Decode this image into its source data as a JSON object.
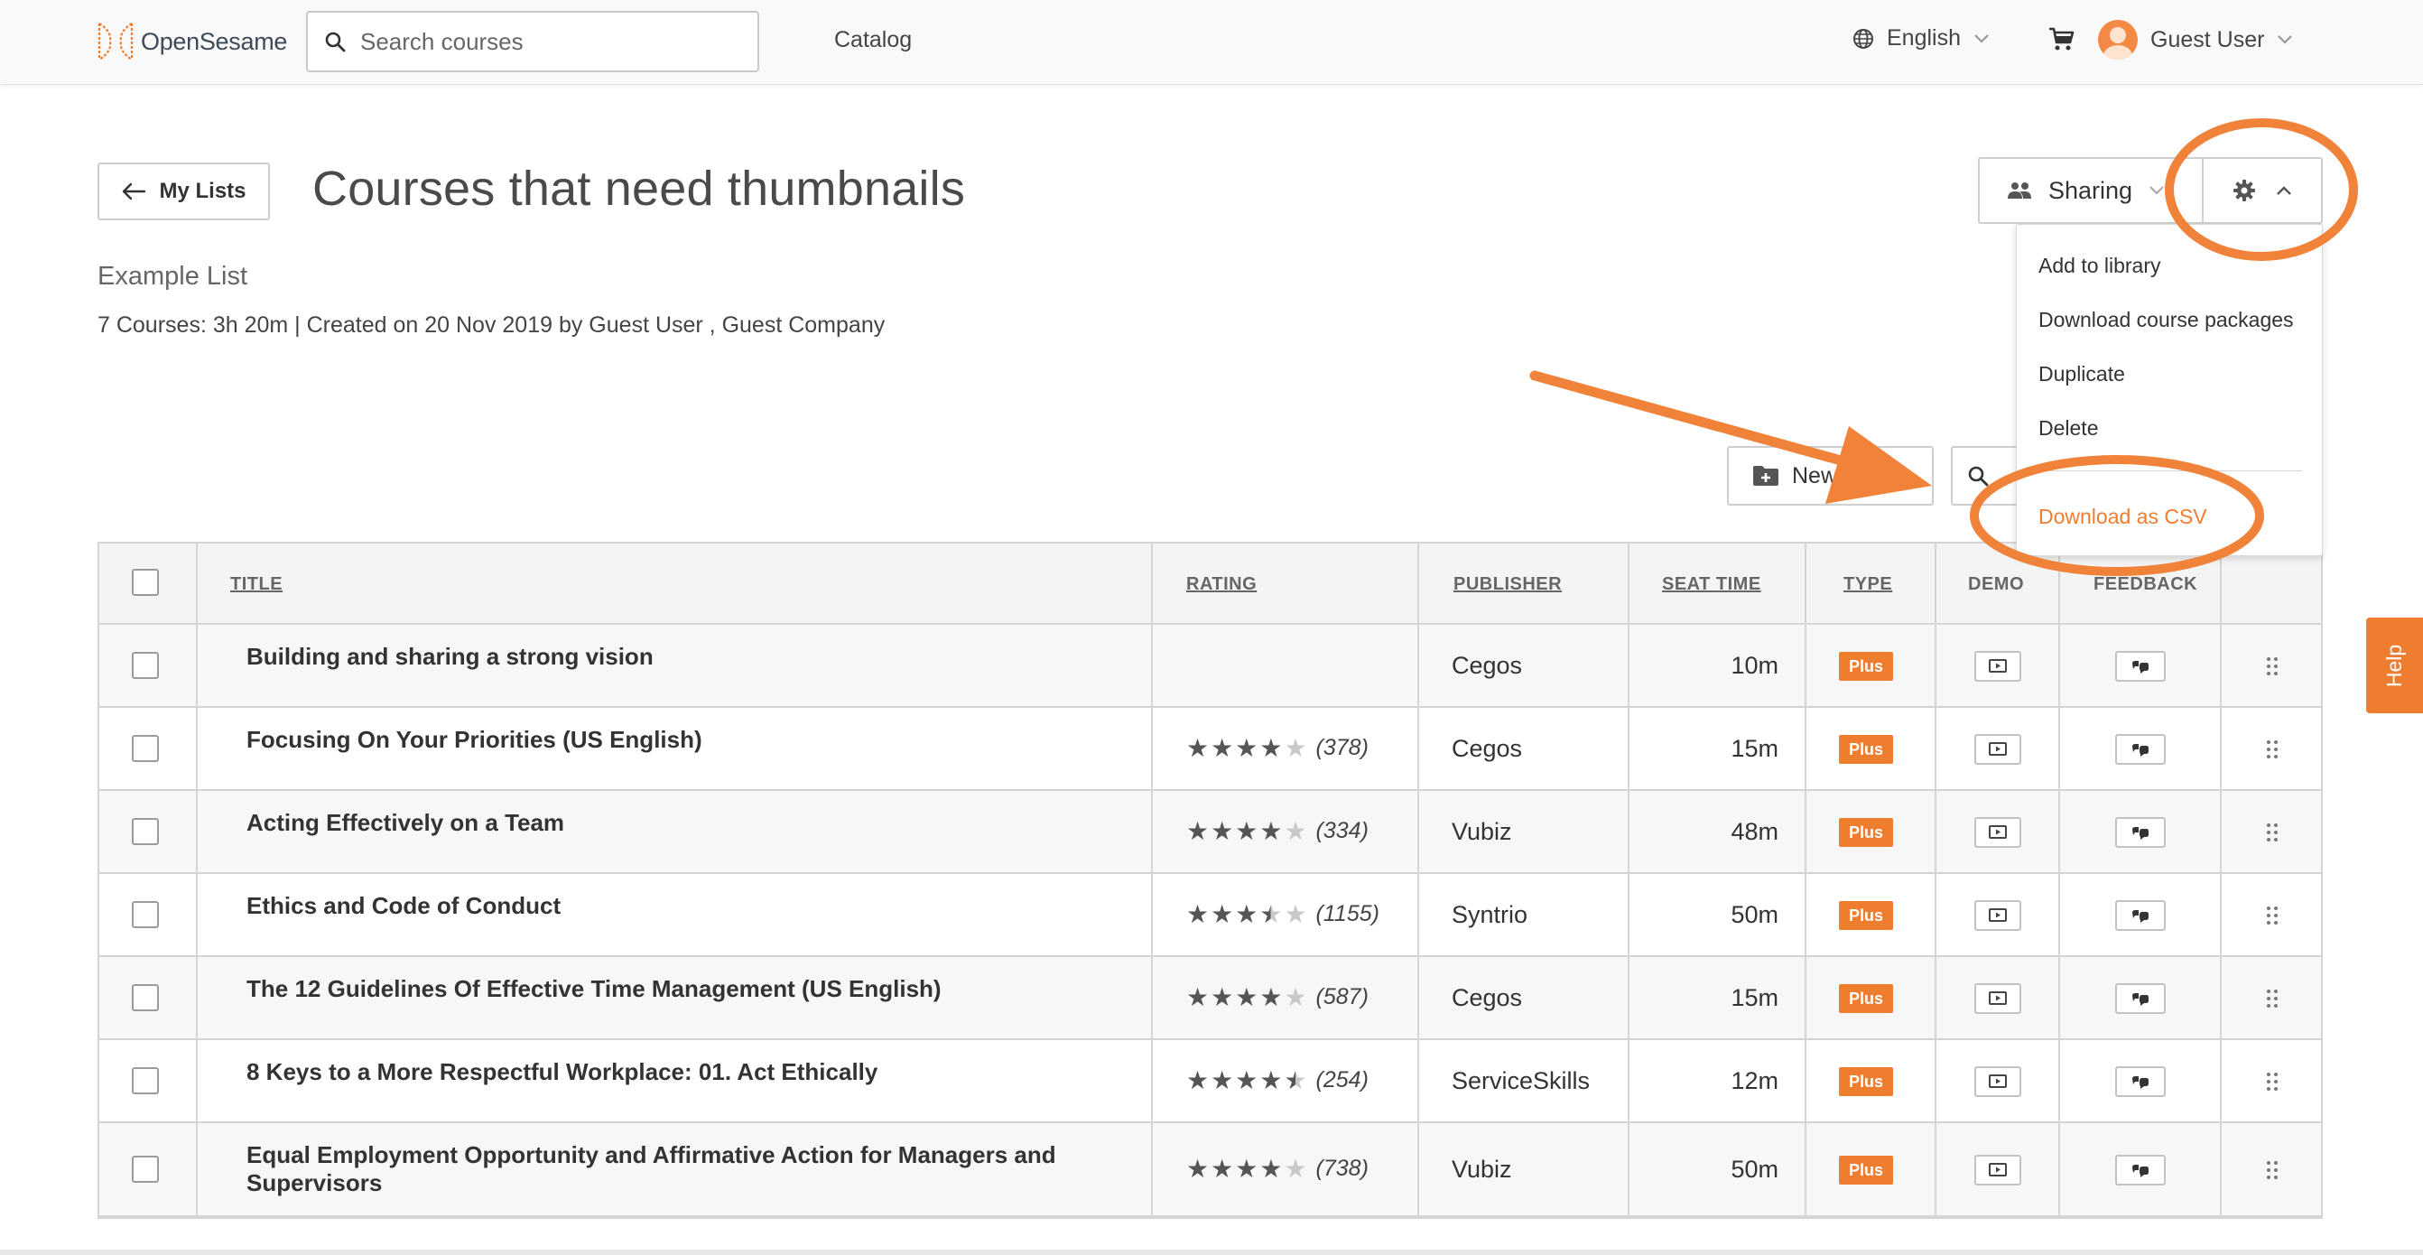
{
  "header": {
    "logo_text": "OpenSesame",
    "search_placeholder": "Search courses",
    "catalog": "Catalog",
    "language": "English",
    "user_name": "Guest User"
  },
  "page": {
    "back_label": "My Lists",
    "title": "Courses that need thumbnails",
    "subtitle": "Example List",
    "meta": "7 Courses: 3h 20m | Created on 20 Nov 2019 by Guest User , Guest Company",
    "sharing_label": "Sharing",
    "new_folder_label": "New Folder"
  },
  "settings_menu": {
    "items": [
      "Add to library",
      "Download course packages",
      "Duplicate",
      "Delete"
    ],
    "csv": "Download as CSV"
  },
  "table": {
    "headers": {
      "title": "TITLE",
      "rating": "RATING",
      "publisher": "PUBLISHER",
      "seat_time": "SEAT TIME",
      "type": "TYPE",
      "demo": "DEMO",
      "feedback": "FEEDBACK"
    },
    "rows": [
      {
        "title": "Building and sharing a strong vision",
        "rating": null,
        "count": "",
        "publisher": "Cegos",
        "seat_time": "10m",
        "type": "Plus"
      },
      {
        "title": "Focusing On Your Priorities (US English)",
        "rating": 4,
        "count": "(378)",
        "publisher": "Cegos",
        "seat_time": "15m",
        "type": "Plus"
      },
      {
        "title": "Acting Effectively on a Team",
        "rating": 4,
        "count": "(334)",
        "publisher": "Vubiz",
        "seat_time": "48m",
        "type": "Plus"
      },
      {
        "title": "Ethics and Code of Conduct",
        "rating": 3.5,
        "count": "(1155)",
        "publisher": "Syntrio",
        "seat_time": "50m",
        "type": "Plus"
      },
      {
        "title": "The 12 Guidelines Of Effective Time Management (US English)",
        "rating": 4,
        "count": "(587)",
        "publisher": "Cegos",
        "seat_time": "15m",
        "type": "Plus"
      },
      {
        "title": "8 Keys to a More Respectful Workplace: 01. Act Ethically",
        "rating": 4.5,
        "count": "(254)",
        "publisher": "ServiceSkills",
        "seat_time": "12m",
        "type": "Plus"
      },
      {
        "title": "Equal Employment Opportunity and Affirmative Action for Managers and Supervisors",
        "rating": 4,
        "count": "(738)",
        "publisher": "Vubiz",
        "seat_time": "50m",
        "type": "Plus"
      }
    ]
  },
  "help_label": "Help",
  "colors": {
    "accent": "#ef7d30",
    "annotation": "#f0823a"
  }
}
